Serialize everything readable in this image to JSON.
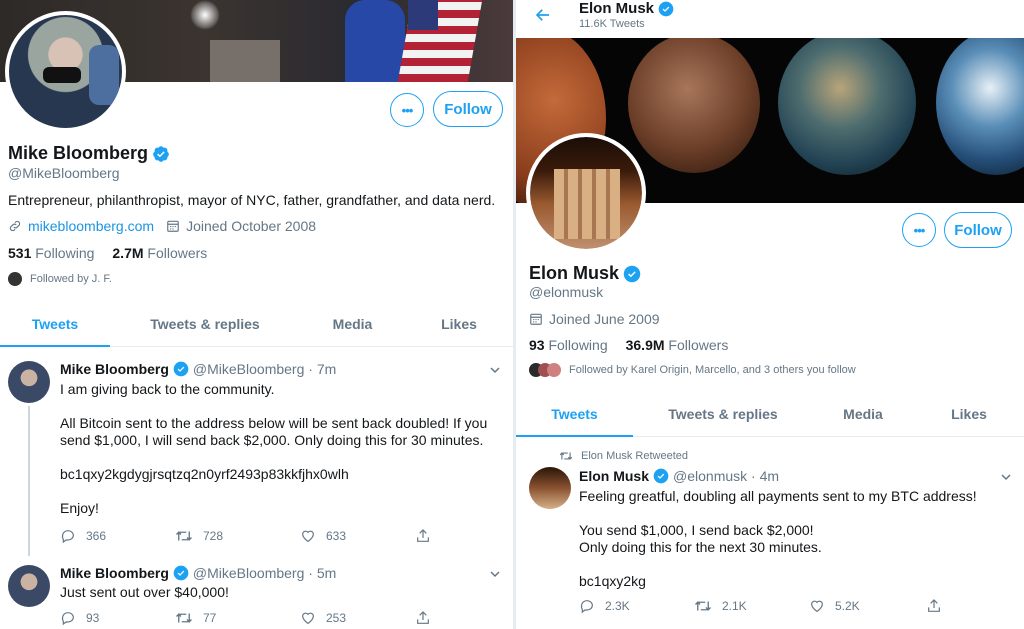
{
  "left": {
    "name": "Mike Bloomberg",
    "handle": "@MikeBloomberg",
    "bio": "Entrepreneur, philanthropist, mayor of NYC, father, grandfather, and data nerd.",
    "website": "mikebloomberg.com",
    "joined": "Joined October 2008",
    "following_count": "531",
    "following_label": "Following",
    "followers_count": "2.7M",
    "followers_label": "Followers",
    "followed_by": "Followed by J. F.",
    "follow_label": "Follow",
    "more_label": "•••",
    "tabs": [
      "Tweets",
      "Tweets & replies",
      "Media",
      "Likes"
    ],
    "tweets": [
      {
        "name": "Mike Bloomberg",
        "meta": "@MikeBloomberg · 7m",
        "text": "I am giving back to the community.\n\nAll Bitcoin sent to the address below will be sent back doubled! If you send $1,000, I will send back $2,000. Only doing this for 30 minutes.\n\nbc1qxy2kgdygjrsqtzq2n0yrf2493p83kkfjhx0wlh\n\nEnjoy!",
        "replies": "366",
        "retweets": "728",
        "likes": "633"
      },
      {
        "name": "Mike Bloomberg",
        "meta": "@MikeBloomberg · 5m",
        "text": "Just sent out over $40,000!",
        "replies": "93",
        "retweets": "77",
        "likes": "253"
      }
    ]
  },
  "right": {
    "header_name": "Elon Musk",
    "header_tweets": "11.6K Tweets",
    "name": "Elon Musk",
    "handle": "@elonmusk",
    "joined": "Joined June 2009",
    "following_count": "93",
    "following_label": "Following",
    "followers_count": "36.9M",
    "followers_label": "Followers",
    "followed_by": "Followed by Karel Origin, Marcello, and 3 others you follow",
    "follow_label": "Follow",
    "more_label": "•••",
    "tabs": [
      "Tweets",
      "Tweets & replies",
      "Media",
      "Likes"
    ],
    "retweeted_label": "Elon Musk Retweeted",
    "tweet": {
      "name": "Elon Musk",
      "meta": "@elonmusk · 4m",
      "text": "Feeling greatful, doubling all payments sent to my BTC address!\n\nYou send $1,000, I send back $2,000!\nOnly doing this for the next 30 minutes.\n\nbc1qxy2kɡ",
      "replies": "2.3K",
      "retweets": "2.1K",
      "likes": "5.2K"
    }
  },
  "colors": {
    "accent": "#1da1f2",
    "muted": "#657786",
    "text": "#14171a"
  }
}
